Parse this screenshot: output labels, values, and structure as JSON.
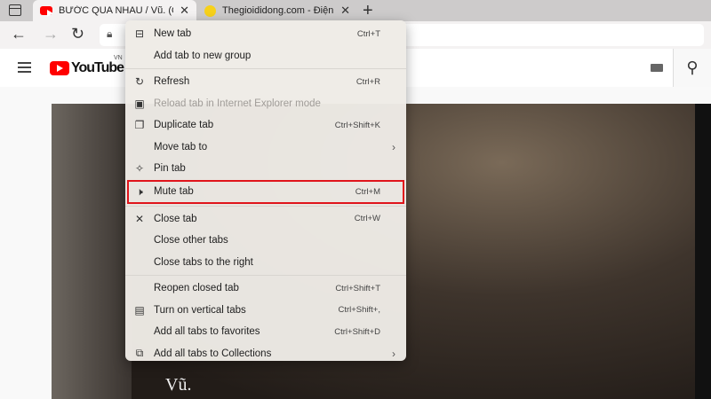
{
  "tabs": [
    {
      "title": "BƯỚC QUA NHAU / Vũ. (Official",
      "favicon": "youtube-icon",
      "close": "✕"
    },
    {
      "title": "Thegioididong.com - Điện thoại",
      "favicon": "tgdd-icon",
      "close": "✕"
    }
  ],
  "new_tab": "+",
  "youtube": {
    "logo": "YouTube",
    "region": "VN"
  },
  "video": {
    "artist_text": "Vũ."
  },
  "menu": {
    "items": [
      {
        "label": "New tab",
        "shortcut": "Ctrl+T",
        "icon": "⊟"
      },
      {
        "label": "Add tab to new group",
        "shortcut": ""
      },
      {
        "label": "Refresh",
        "shortcut": "Ctrl+R",
        "icon": "↻"
      },
      {
        "label": "Reload tab in Internet Explorer mode",
        "shortcut": "",
        "icon": "▣"
      },
      {
        "label": "Duplicate tab",
        "shortcut": "Ctrl+Shift+K",
        "icon": "❐"
      },
      {
        "label": "Move tab to",
        "shortcut": "",
        "arrow": "›"
      },
      {
        "label": "Pin tab",
        "shortcut": "",
        "icon": "✧"
      },
      {
        "label": "Mute tab",
        "shortcut": "Ctrl+M",
        "icon": "🕨"
      },
      {
        "label": "Close tab",
        "shortcut": "Ctrl+W",
        "icon": "✕"
      },
      {
        "label": "Close other tabs",
        "shortcut": ""
      },
      {
        "label": "Close tabs to the right",
        "shortcut": ""
      },
      {
        "label": "Reopen closed tab",
        "shortcut": "Ctrl+Shift+T"
      },
      {
        "label": "Turn on vertical tabs",
        "shortcut": "Ctrl+Shift+,",
        "icon": "▤"
      },
      {
        "label": "Add all tabs to favorites",
        "shortcut": "Ctrl+Shift+D"
      },
      {
        "label": "Add all tabs to Collections",
        "shortcut": "",
        "icon": "⧉",
        "arrow": "›"
      }
    ]
  },
  "colors": {
    "highlight": "#e0141b",
    "youtube_red": "#ff0000"
  }
}
